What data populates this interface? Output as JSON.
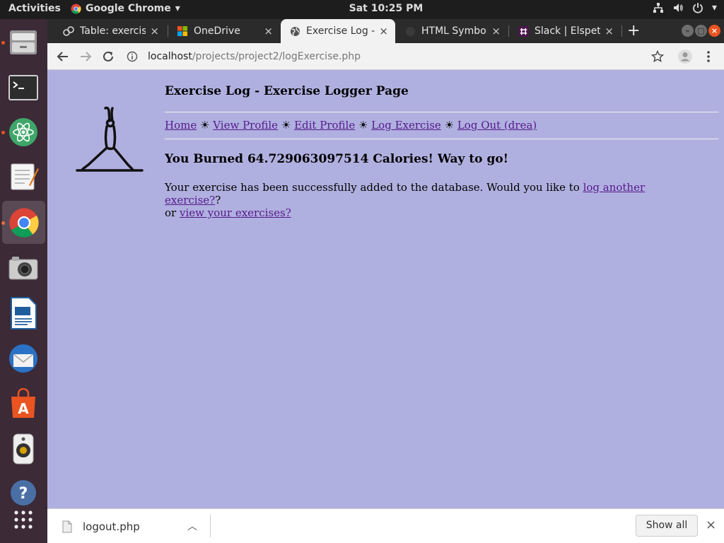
{
  "topbar": {
    "activities": "Activities",
    "app_name": "Google Chrome",
    "clock": "Sat 10:25 PM"
  },
  "dock": {
    "items": [
      "files-icon",
      "terminal-icon",
      "atom-icon",
      "text-editor-icon",
      "chrome-icon",
      "camera-icon",
      "libreoffice-writer-icon",
      "thunderbird-icon",
      "software-center-icon",
      "speaker-icon",
      "help-icon",
      "app-grid-icon"
    ]
  },
  "tabs": [
    {
      "title": "Table: exercise",
      "close": "×"
    },
    {
      "title": "OneDrive",
      "close": "×"
    },
    {
      "title": "Exercise Log -",
      "close": "×",
      "active": true
    },
    {
      "title": "HTML Symbol",
      "close": "×"
    },
    {
      "title": "Slack | Elspeth",
      "close": "×"
    }
  ],
  "address_bar": {
    "host": "localhost",
    "path": "/projects/project2/logExercise.php"
  },
  "page": {
    "title": "Exercise Log - Exercise Logger Page",
    "nav": {
      "home": "Home",
      "view_profile": "View Profile",
      "edit_profile": "Edit Profile",
      "log_exercise": "Log Exercise",
      "log_out": "Log Out (drea)",
      "separator": "☀"
    },
    "heading": "You Burned 64.729063097514 Calories! Way to go!",
    "message_prefix": "Your exercise has been successfully added to the database. Would you like to ",
    "log_another_link": "log another exercise?",
    "message_mid": "?",
    "message_or": "or ",
    "view_exercises_link": "view your exercises?"
  },
  "download_bar": {
    "filename": "logout.php",
    "show_all": "Show all",
    "close": "×"
  }
}
